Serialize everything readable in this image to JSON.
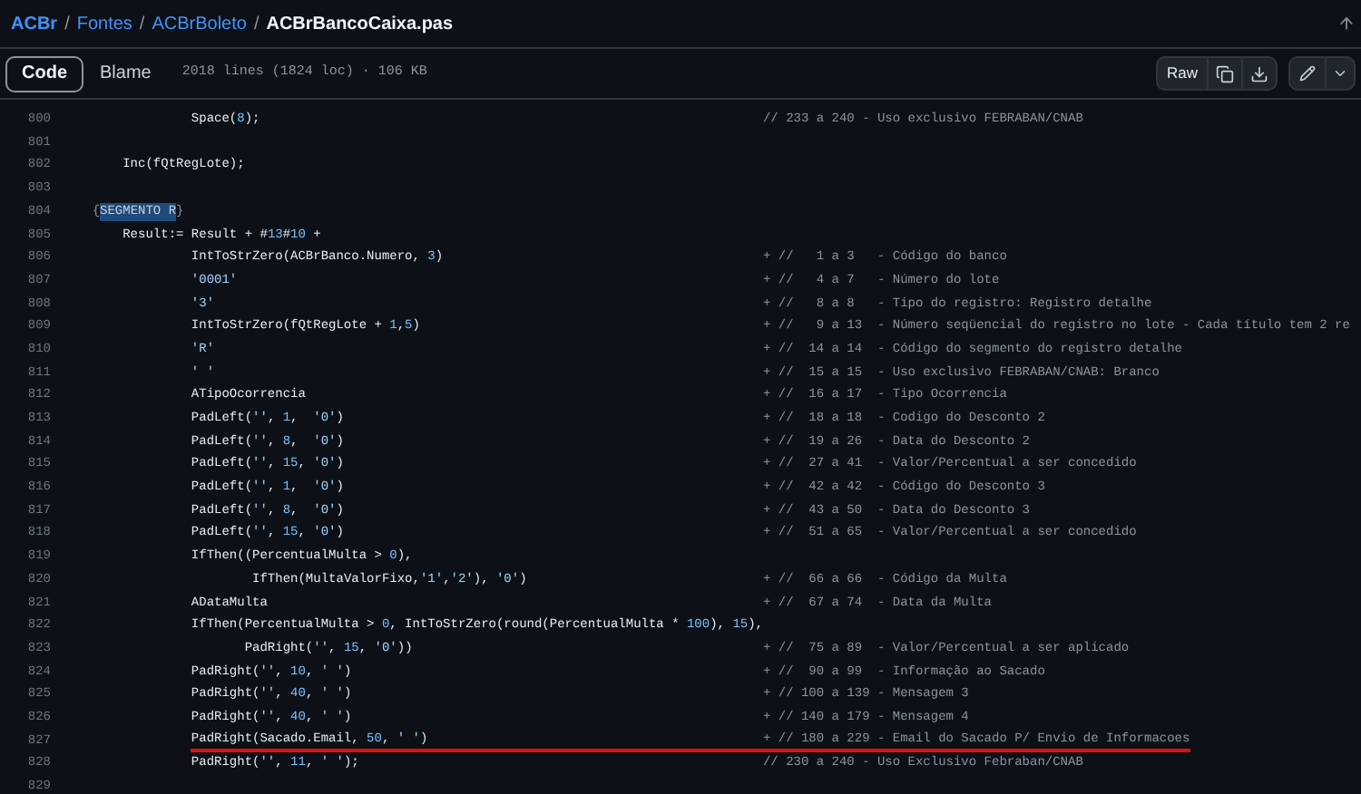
{
  "breadcrumb": {
    "links": [
      "ACBr",
      "Fontes",
      "ACBrBoleto"
    ],
    "separator": "/",
    "current": "ACBrBancoCaixa.pas"
  },
  "toolbar": {
    "tabs": [
      {
        "label": "Code",
        "selected": true
      },
      {
        "label": "Blame",
        "selected": false
      }
    ],
    "file_info": "2018 lines (1824 loc) · 106 KB",
    "raw_button": "Raw"
  },
  "code": {
    "lines": [
      {
        "number": "800",
        "code": [
          {
            "text": "                 Space(8);",
            "highlighted": false
          }
        ],
        "comment": "// 233 a 240 - Uso exclusivo FEBRABAN/CNAB",
        "underlined": false
      },
      {
        "number": "801",
        "underlined": false
      },
      {
        "number": "802",
        "code": [
          {
            "text": "        Inc(fQtRegLote);",
            "highlighted": false
          }
        ],
        "underlined": false
      },
      {
        "number": "803",
        "underlined": false
      },
      {
        "number": "804",
        "code": [
          {
            "text": "    {",
            "highlighted": false
          },
          {
            "text": "SEGMENTO R",
            "highlighted": true
          },
          {
            "text": "}",
            "highlighted": false
          }
        ],
        "underlined": false
      },
      {
        "number": "805",
        "code": [
          {
            "text": "        Result:= Result + #13#10 +",
            "highlighted": false
          }
        ],
        "underlined": false
      },
      {
        "number": "806",
        "code": [
          {
            "text": "                 IntToStrZero(ACBrBanco.Numero, 3)",
            "highlighted": false
          }
        ],
        "comment": "+ //   1 a 3   - Código do banco",
        "underlined": false
      },
      {
        "number": "807",
        "code": [
          {
            "text": "                 '0001'",
            "highlighted": false
          }
        ],
        "comment": "+ //   4 a 7   - Número do lote",
        "underlined": false
      },
      {
        "number": "808",
        "code": [
          {
            "text": "                 '3'",
            "highlighted": false
          }
        ],
        "comment": "+ //   8 a 8   - Tipo do registro: Registro detalhe",
        "underlined": false
      },
      {
        "number": "809",
        "code": [
          {
            "text": "                 IntToStrZero(fQtRegLote + 1,5)",
            "highlighted": false
          }
        ],
        "comment": "+ //   9 a 13  - Número seqüencial do registro no lote - Cada título tem 2 re",
        "underlined": false
      },
      {
        "number": "810",
        "code": [
          {
            "text": "                 'R'",
            "highlighted": false
          }
        ],
        "comment": "+ //  14 a 14  - Código do segmento do registro detalhe",
        "underlined": false
      },
      {
        "number": "811",
        "code": [
          {
            "text": "                 ' '",
            "highlighted": false
          }
        ],
        "comment": "+ //  15 a 15  - Uso exclusivo FEBRABAN/CNAB: Branco",
        "underlined": false
      },
      {
        "number": "812",
        "code": [
          {
            "text": "                 ATipoOcorrencia",
            "highlighted": false
          }
        ],
        "comment": "+ //  16 a 17  - Tipo Ocorrencia",
        "underlined": false
      },
      {
        "number": "813",
        "code": [
          {
            "text": "                 PadLeft('', 1,  '0')",
            "highlighted": false
          }
        ],
        "comment": "+ //  18 a 18  - Codigo do Desconto 2",
        "underlined": false
      },
      {
        "number": "814",
        "code": [
          {
            "text": "                 PadLeft('', 8,  '0')",
            "highlighted": false
          }
        ],
        "comment": "+ //  19 a 26  - Data do Desconto 2",
        "underlined": false
      },
      {
        "number": "815",
        "code": [
          {
            "text": "                 PadLeft('', 15, '0')",
            "highlighted": false
          }
        ],
        "comment": "+ //  27 a 41  - Valor/Percentual a ser concedido",
        "underlined": false
      },
      {
        "number": "816",
        "code": [
          {
            "text": "                 PadLeft('', 1,  '0')",
            "highlighted": false
          }
        ],
        "comment": "+ //  42 a 42  - Código do Desconto 3",
        "underlined": false
      },
      {
        "number": "817",
        "code": [
          {
            "text": "                 PadLeft('', 8,  '0')",
            "highlighted": false
          }
        ],
        "comment": "+ //  43 a 50  - Data do Desconto 3",
        "underlined": false
      },
      {
        "number": "818",
        "code": [
          {
            "text": "                 PadLeft('', 15, '0')",
            "highlighted": false
          }
        ],
        "comment": "+ //  51 a 65  - Valor/Percentual a ser concedido",
        "underlined": false
      },
      {
        "number": "819",
        "code": [
          {
            "text": "                 IfThen((PercentualMulta > 0),",
            "highlighted": false
          }
        ],
        "underlined": false
      },
      {
        "number": "820",
        "code": [
          {
            "text": "                         IfThen(MultaValorFixo,'1','2'), '0')",
            "highlighted": false
          }
        ],
        "comment": "+ //  66 a 66  - Código da Multa",
        "underlined": false
      },
      {
        "number": "821",
        "code": [
          {
            "text": "                 ADataMulta",
            "highlighted": false
          }
        ],
        "comment": "+ //  67 a 74  - Data da Multa",
        "underlined": false
      },
      {
        "number": "822",
        "code": [
          {
            "text": "                 IfThen(PercentualMulta > 0, IntToStrZero(round(PercentualMulta * 100), 15),",
            "highlighted": false
          }
        ],
        "underlined": false
      },
      {
        "number": "823",
        "code": [
          {
            "text": "                        PadRight('', 15, '0'))",
            "highlighted": false
          }
        ],
        "comment": "+ //  75 a 89  - Valor/Percentual a ser aplicado",
        "underlined": false
      },
      {
        "number": "824",
        "code": [
          {
            "text": "                 PadRight('', 10, ' ')",
            "highlighted": false
          }
        ],
        "comment": "+ //  90 a 99  - Informação ao Sacado",
        "underlined": false
      },
      {
        "number": "825",
        "code": [
          {
            "text": "                 PadRight('', 40, ' ')",
            "highlighted": false
          }
        ],
        "comment": "+ // 100 a 139 - Mensagem 3",
        "underlined": false
      },
      {
        "number": "826",
        "code": [
          {
            "text": "                 PadRight('', 40, ' ')",
            "highlighted": false
          }
        ],
        "comment": "+ // 140 a 179 - Mensagem 4",
        "underlined": false
      },
      {
        "number": "827",
        "code": [
          {
            "text": "                 PadRight(Sacado.Email, 50, ' ')",
            "highlighted": false
          }
        ],
        "comment": "+ // 180 a 229 - Email do Sacado P/ Envio de Informacoes",
        "underlined": true
      },
      {
        "number": "828",
        "code": [
          {
            "text": "                 PadRight('', 11, ' ');",
            "highlighted": false
          }
        ],
        "comment": "// 230 a 240 - Uso Exclusivo Febraban/CNAB",
        "underlined": false
      },
      {
        "number": "829",
        "underlined": false
      }
    ]
  }
}
